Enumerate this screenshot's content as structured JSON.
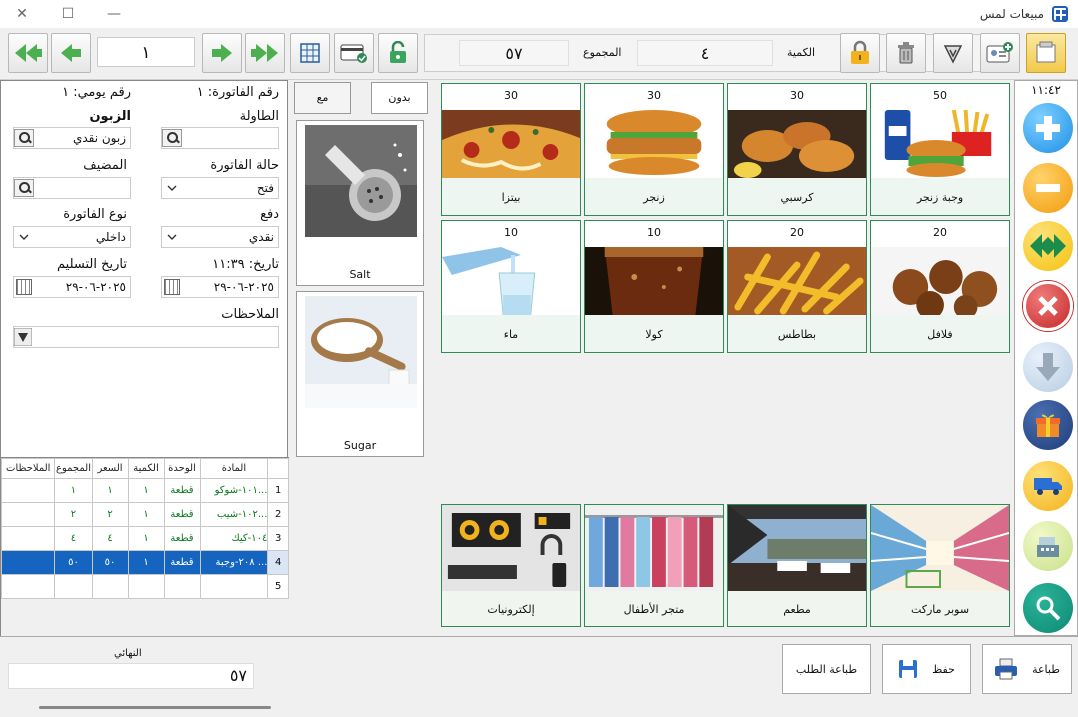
{
  "window": {
    "title": "مبيعات لمس",
    "minimize": "—",
    "maximize": "☐",
    "close": "✕"
  },
  "toolbar": {
    "record_number": "١",
    "quantity_label": "الكمية",
    "quantity_value": "٤",
    "total_label": "المجموع",
    "total_value": "٥٧"
  },
  "invoice": {
    "invoice_no": "رقم الفاتورة: ١",
    "daily_no": "رقم يومي: ١",
    "table_label": "الطاولة",
    "customer_label": "الزبون",
    "customer_value": "زبون نقدي",
    "host_label": "المضيف",
    "status_label": "حالة الفاتورة",
    "status_value": "فتح",
    "payment_label": "دفع",
    "payment_value": "نقدي",
    "type_label": "نوع الفاتورة",
    "type_value": "داخلي",
    "date_label": "تاريخ: ١١:٣٩",
    "date_value": "٢٠٢٥-٠٦-٢٩",
    "delivery_label": "تاريخ التسليم",
    "delivery_value": "٢٠٢٥-٠٦-٢٩",
    "notes_label": "الملاحظات"
  },
  "grid": {
    "headers": [
      "",
      "المادة",
      "الوحدة",
      "الكمية",
      "السعر",
      "المجموع",
      "الملاحظات"
    ],
    "rows": [
      {
        "n": "1",
        "item": "١٠١-شوكو...",
        "unit": "قطعة",
        "qty": "١",
        "price": "١",
        "total": "١",
        "note": ""
      },
      {
        "n": "2",
        "item": "١٠٢-شيب...",
        "unit": "قطعة",
        "qty": "١",
        "price": "٢",
        "total": "٢",
        "note": ""
      },
      {
        "n": "3",
        "item": "١٠٤-كيك",
        "unit": "قطعة",
        "qty": "١",
        "price": "٤",
        "total": "٤",
        "note": ""
      },
      {
        "n": "4",
        "item": "٢٠٨-وجبة ...",
        "unit": "قطعة",
        "qty": "١",
        "price": "٥٠",
        "total": "٥٠",
        "note": ""
      },
      {
        "n": "5",
        "item": "",
        "unit": "",
        "qty": "",
        "price": "",
        "total": "",
        "note": ""
      }
    ]
  },
  "modifiers": {
    "with": "مع",
    "without": "بدون",
    "items": [
      "Salt",
      "Sugar"
    ]
  },
  "products": [
    {
      "price": "30",
      "name": "بيتزا"
    },
    {
      "price": "30",
      "name": "زنجر"
    },
    {
      "price": "30",
      "name": "كرسبي"
    },
    {
      "price": "50",
      "name": "وجبة زنجر"
    },
    {
      "price": "10",
      "name": "ماء"
    },
    {
      "price": "10",
      "name": "كولا"
    },
    {
      "price": "20",
      "name": "بطاطس"
    },
    {
      "price": "20",
      "name": "فلافل"
    }
  ],
  "categories": [
    {
      "name": "إلكترونيات"
    },
    {
      "name": "متجر الأطفال"
    },
    {
      "name": "مطعم"
    },
    {
      "name": "سوبر ماركت"
    }
  ],
  "sidebar": {
    "time": "١١:٤٢"
  },
  "footer": {
    "final_label": "النهائي",
    "final_value": "٥٧",
    "print": "طباعة",
    "save": "حفظ",
    "print_order": "طباعة الطلب"
  },
  "colors": {
    "accent_blue": "#1565c0",
    "product_border": "#2e8b57",
    "nav_green": "#4caf50"
  }
}
